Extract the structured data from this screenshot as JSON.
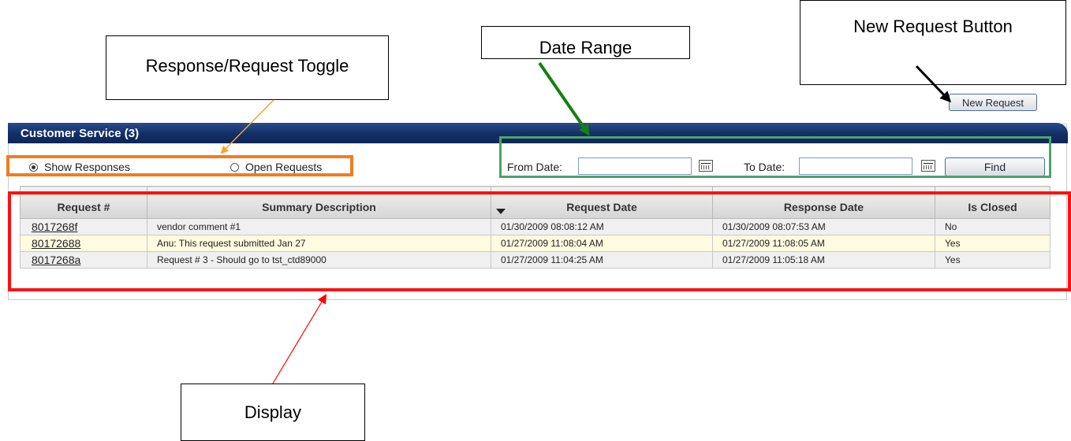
{
  "callouts": {
    "toggle": "Response/Request Toggle",
    "date_range": "Date Range",
    "new_request": "New Request Button",
    "display": "Display"
  },
  "toolbar": {
    "new_request_label": "New Request"
  },
  "panel": {
    "title": "Customer Service (3)"
  },
  "filters": {
    "show_responses_label": "Show Responses",
    "open_requests_label": "Open Requests",
    "selected": "Show Responses",
    "from_label": "From Date:",
    "to_label": "To Date:",
    "from_value": "",
    "to_value": "",
    "find_label": "Find"
  },
  "table": {
    "headers": {
      "request": "Request #",
      "summary": "Summary Description",
      "request_date": "Request Date",
      "response_date": "Response Date",
      "closed": "Is Closed"
    },
    "sorted_column": "Request Date",
    "rows": [
      {
        "request": "8017268f",
        "summary": "vendor comment #1",
        "request_date": "01/30/2009 08:08:12 AM",
        "response_date": "01/30/2009 08:07:53 AM",
        "closed": "No"
      },
      {
        "request": "80172688",
        "summary": "Anu: This request submitted Jan 27",
        "request_date": "01/27/2009 11:08:04 AM",
        "response_date": "01/27/2009 11:08:05 AM",
        "closed": "Yes"
      },
      {
        "request": "8017268a",
        "summary": "Request # 3 - Should go to tst_ctd89000",
        "request_date": "01/27/2009 11:04:25 AM",
        "response_date": "01/27/2009 11:05:18 AM",
        "closed": "Yes"
      }
    ]
  },
  "colors": {
    "toggle_highlight": "#f47b20",
    "date_highlight": "#4aa36a",
    "display_highlight": "#ff1010",
    "header_bar": "#112e66",
    "alt_row": "#fdfbe0"
  }
}
